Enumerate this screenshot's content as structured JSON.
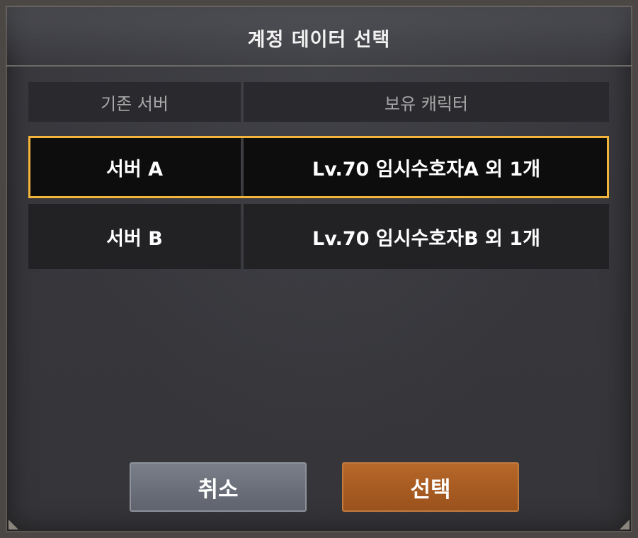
{
  "dialog": {
    "title": "계정 데이터 선택"
  },
  "table": {
    "headers": {
      "server": "기존 서버",
      "characters": "보유 캐릭터"
    },
    "rows": [
      {
        "server": "서버 A",
        "characters": "Lv.70 임시수호자A 외 1개",
        "selected": true
      },
      {
        "server": "서버 B",
        "characters": "Lv.70 임시수호자B 외 1개",
        "selected": false
      }
    ]
  },
  "buttons": {
    "cancel_label": "취소",
    "select_label": "선택"
  },
  "colors": {
    "selection_border": "#f2b43a",
    "select_button": "#a85c22",
    "cancel_button": "#6c707a"
  }
}
